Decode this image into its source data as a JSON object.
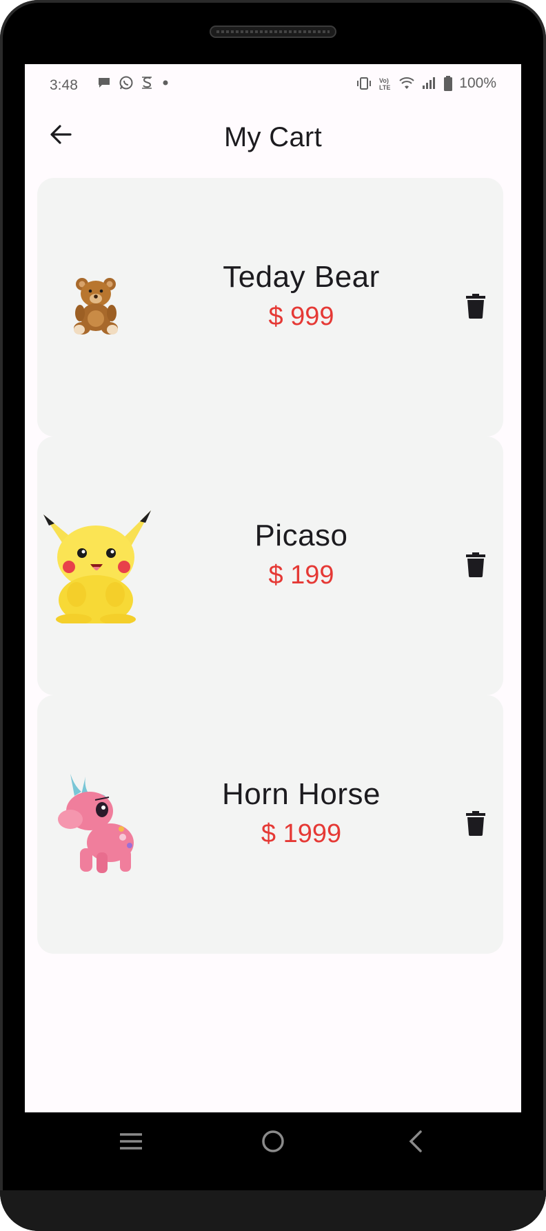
{
  "status_bar": {
    "time": "3:48",
    "battery": "100%",
    "notification_icons": [
      "chat-bubble-icon",
      "whatsapp-icon",
      "s-app-icon",
      "dot-icon"
    ],
    "system_icons": [
      "vibrate-icon",
      "volte-icon",
      "wifi-icon",
      "signal-icon",
      "battery-icon"
    ]
  },
  "app_bar": {
    "title": "My Cart",
    "back_icon": "arrow-left-icon"
  },
  "cart": {
    "items": [
      {
        "name": "Teday Bear",
        "price": "$ 999",
        "image": "teddy-bear-icon"
      },
      {
        "name": "Picaso",
        "price": "$ 199",
        "image": "pikachu-plush-icon"
      },
      {
        "name": "Horn Horse",
        "price": "$ 1999",
        "image": "unicorn-plush-icon"
      }
    ],
    "delete_icon": "trash-icon"
  },
  "colors": {
    "price": "#e53935",
    "card_bg": "#f3f4f3",
    "screen_bg": "#fffbfe",
    "text": "#1c1b1f"
  },
  "nav_bar": {
    "buttons": [
      "recents-icon",
      "home-icon",
      "back-icon"
    ]
  }
}
